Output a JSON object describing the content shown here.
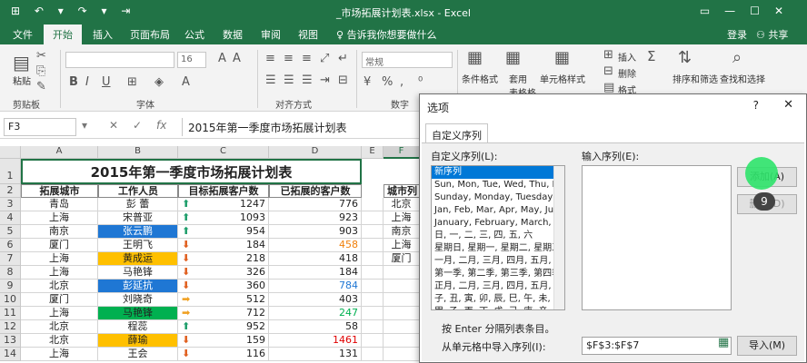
{
  "window": {
    "title": "_市场拓展计划表.xlsx - Excel",
    "controls": [
      "▭",
      "—",
      "☐",
      "✕"
    ]
  },
  "quick_access": "⊞  ↶ ▾  ↷ ▾  ⇥",
  "tabs": [
    "文件",
    "开始",
    "插入",
    "页面布局",
    "公式",
    "数据",
    "审阅",
    "视图"
  ],
  "active_tab": "开始",
  "tell_me": "告诉我你想要做什么",
  "signin": "登录",
  "share": "共享",
  "ribbon": {
    "paste": "粘贴",
    "clipboard": "剪贴板",
    "font": "字体",
    "font_size": "16",
    "alignment": "对齐方式",
    "number_format": "常规",
    "number": "数字",
    "cond_format": "条件格式",
    "table_format": "套用\n表格格式",
    "cell_style": "单元格样式",
    "insert": "插入",
    "delete": "删除",
    "format": "格式",
    "cells": "单元格",
    "sum": "Σ",
    "sort": "排序和筛选",
    "find": "查找和选择",
    "edit": "编辑"
  },
  "formula_bar": {
    "name_box": "F3",
    "content": "2015年第一季度市场拓展计划表"
  },
  "sheet": {
    "columns": [
      "A",
      "B",
      "C",
      "D",
      "E",
      "F"
    ],
    "title": "2015年第一季度市场拓展计划表",
    "headers": [
      "拓展城市",
      "工作人员",
      "目标拓展客户数",
      "已拓展的客户数",
      "",
      "城市列"
    ],
    "rows": [
      {
        "n": "3",
        "city": "青岛",
        "person": "彭  蕾",
        "target": "1247",
        "done": "776",
        "arrow": "up",
        "f": "北京"
      },
      {
        "n": "4",
        "city": "上海",
        "person": "宋普亚",
        "target": "1093",
        "done": "923",
        "arrow": "up",
        "f": "上海"
      },
      {
        "n": "5",
        "city": "南京",
        "person": "张云鹏",
        "target": "954",
        "done": "903",
        "arrow": "up",
        "f": "南京",
        "fill": "blue"
      },
      {
        "n": "6",
        "city": "厦门",
        "person": "王明飞",
        "target": "184",
        "done": "458",
        "arrow": "down",
        "f": "上海",
        "doneColor": "orange"
      },
      {
        "n": "7",
        "city": "上海",
        "person": "黄成运",
        "target": "218",
        "done": "418",
        "arrow": "down",
        "f": "厦门",
        "fill": "yellow"
      },
      {
        "n": "8",
        "city": "上海",
        "person": "马艳锋",
        "target": "326",
        "done": "184",
        "arrow": "down",
        "f": ""
      },
      {
        "n": "9",
        "city": "北京",
        "person": "彭延抗",
        "target": "360",
        "done": "784",
        "arrow": "down",
        "f": "",
        "fill": "blue",
        "doneColor": "blue"
      },
      {
        "n": "10",
        "city": "厦门",
        "person": "刘晓奇",
        "target": "512",
        "done": "403",
        "arrow": "side",
        "f": ""
      },
      {
        "n": "11",
        "city": "上海",
        "person": "马艳锋",
        "target": "712",
        "done": "247",
        "arrow": "side",
        "f": "",
        "fill": "green",
        "doneColor": "green"
      },
      {
        "n": "12",
        "city": "北京",
        "person": "程蕊",
        "target": "952",
        "done": "58",
        "arrow": "up",
        "f": ""
      },
      {
        "n": "13",
        "city": "北京",
        "person": "薛瑜",
        "target": "159",
        "done": "1461",
        "arrow": "down",
        "f": "",
        "fill": "yellow",
        "doneColor": "red"
      },
      {
        "n": "14",
        "city": "上海",
        "person": "王会",
        "target": "116",
        "done": "131",
        "arrow": "down",
        "f": ""
      }
    ]
  },
  "dialog": {
    "title": "选项",
    "help": "?",
    "close": "✕",
    "tab": "自定义序列",
    "list_label": "自定义序列(L):",
    "input_label": "输入序列(E):",
    "list_items": [
      "新序列",
      "Sun, Mon, Tue, Wed, Thu, Fri, S",
      "Sunday, Monday, Tuesday, We",
      "Jan, Feb, Mar, Apr, May, Jun,",
      "January, February, March, Apri",
      "日, 一, 二, 三, 四, 五, 六",
      "星期日, 星期一, 星期二, 星期三",
      "一月, 二月, 三月, 四月, 五月, 六",
      "第一季, 第二季, 第三季, 第四季",
      "正月, 二月, 三月, 四月, 五月, 六",
      "子, 丑, 寅, 卯, 辰, 巳, 午, 未, 申",
      "甲, 乙, 丙, 丁, 戊, 己, 庚, 辛, 壬"
    ],
    "add_button": "添加(A)",
    "delete_button": "删除(D)",
    "hint": "按 Enter 分隔列表条目。",
    "import_label": "从单元格中导入序列(I):",
    "import_ref": "$F$3:$F$7",
    "import_button": "导入(M)",
    "step_badge": "9"
  }
}
